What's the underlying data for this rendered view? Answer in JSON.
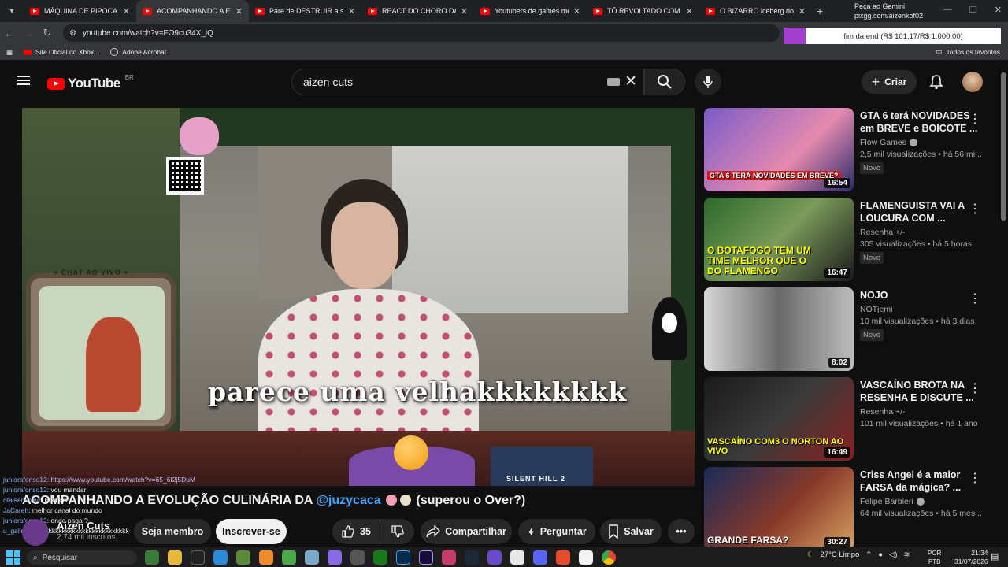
{
  "browser": {
    "tabs": [
      {
        "title": "MÁQUINA DE PIPOCA DO",
        "active": false
      },
      {
        "title": "ACOMPANHANDO A EVOL",
        "active": true
      },
      {
        "title": "Pare de DESTRUIR a sua pa",
        "active": false
      },
      {
        "title": "REACT DO CHORO DA GA",
        "active": false
      },
      {
        "title": "Youtubers de games me o",
        "active": false
      },
      {
        "title": "TÔ REVOLTADO COM A SE",
        "active": false
      },
      {
        "title": "O BIZARRO iceberg dos co",
        "active": false
      }
    ],
    "new_tab": "+",
    "gemini": {
      "line1": "Peça ao Gemini",
      "line2": "pixgg.com/aizenkof02"
    },
    "url": "youtube.com/watch?v=FO9cu34X_iQ",
    "donation_text": "fim da end (R$ 101,17/R$ 1.000,00)",
    "donation_progress": 0.10117,
    "bookmarks": [
      {
        "label": "Site Oficial do Xbox...",
        "icon": "youtube-icon"
      },
      {
        "label": "Adobe Acrobat",
        "icon": "acrobat-icon"
      }
    ],
    "all_favorites": "Todos os favoritos"
  },
  "youtube": {
    "logo_text": "YouTube",
    "region": "BR",
    "search_query": "aizen cuts",
    "create_label": "Criar"
  },
  "video": {
    "caption": "parece uma velhakkkkkkkk",
    "overlay_chat_label": "+ CHAT AO VIVO +",
    "overlay_game_label": "SILENT HILL 2",
    "title_prefix": "ACOMPANHANDO A EVOLUÇÃO CULINÁRIA DA ",
    "title_tag": "@juzycaca",
    "title_suffix": " (superou o Over?)",
    "channel_name": "Aizen Cuts",
    "subscribers": "2,74 mil inscritos",
    "join_label": "Seja membro",
    "subscribe_label": "Inscrever-se",
    "likes": "35",
    "share_label": "Compartilhar",
    "ask_label": "Perguntar",
    "save_label": "Salvar"
  },
  "overlay_chat": [
    {
      "user": "juniorafonso12",
      "msg": ": https://www.youtube.com/watch?v=65_6I2j5DuM"
    },
    {
      "user": "juniorafonso12",
      "msg": ": vou mandar"
    },
    {
      "user": "otaisenkovvr",
      "msg": ": kkkkkkk"
    },
    {
      "user": "JaCareh",
      "msg": ": melhor canal do mundo"
    },
    {
      "user": "juniorafonso12",
      "msg": ": onde paga ?"
    },
    {
      "user": "u_galin",
      "msg": ": kkkkkkkkkkkkkkkkkkkkkkkkkkkkkk"
    }
  ],
  "recommendations": [
    {
      "title": "GTA 6 terá NOVIDADES em BREVE e BOICOTE ...",
      "channel": "Flow Games",
      "verified": true,
      "views": "2,5 mil visualizações",
      "age": "há 56 mi...",
      "badge": "Novo",
      "duration": "16:54",
      "thumb_text": "GTA 6 TERÁ NOVIDADES EM BREVE?"
    },
    {
      "title": "FLAMENGUISTA VAI A LOUCURA COM ...",
      "channel": "Resenha +/-",
      "verified": false,
      "views": "305 visualizações",
      "age": "há 5 horas",
      "badge": "Novo",
      "duration": "16:47",
      "thumb_text": "O BOTAFOGO TEM UM TIME MELHOR QUE O DO FLAMENGO"
    },
    {
      "title": "NOJO",
      "channel": "NOTjemi",
      "verified": false,
      "views": "10 mil visualizações",
      "age": "há 3 dias",
      "badge": "Novo",
      "duration": "8:02",
      "thumb_text": ""
    },
    {
      "title": "VASCAÍNO BROTA NA RESENHA E DISCUTE ...",
      "channel": "Resenha +/-",
      "verified": false,
      "views": "101 mil visualizações",
      "age": "há 1 ano",
      "badge": "",
      "duration": "16:49",
      "thumb_text": "VASCAÍNO COM3 O NORTON AO VIVO"
    },
    {
      "title": "Criss Angel é a maior FARSA da mágica? ...",
      "channel": "Felipe Barbieri",
      "verified": true,
      "views": "64 mil visualizações",
      "age": "há 5 mes...",
      "badge": "",
      "duration": "30:27",
      "thumb_text": "GRANDE FARSA?"
    }
  ],
  "taskbar": {
    "search_placeholder": "Pesquisar",
    "weather": "27°C  Limpo",
    "lang1": "POR",
    "lang2": "PTB",
    "time": "21:34",
    "date": "31/07/2026"
  }
}
